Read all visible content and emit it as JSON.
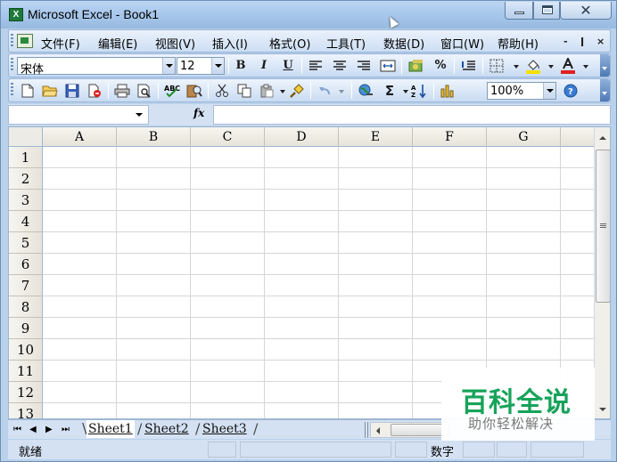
{
  "window": {
    "title": "Microsoft Excel - Book1",
    "close_glyph": "✕"
  },
  "menubar": {
    "items": [
      {
        "label": "文件",
        "mnemonic": "(F)"
      },
      {
        "label": "编辑",
        "mnemonic": "(E)"
      },
      {
        "label": "视图",
        "mnemonic": "(V)"
      },
      {
        "label": "插入",
        "mnemonic": "(I)"
      },
      {
        "label": "格式",
        "mnemonic": "(O)"
      },
      {
        "label": "工具",
        "mnemonic": "(T)"
      },
      {
        "label": "数据",
        "mnemonic": "(D)"
      },
      {
        "label": "窗口",
        "mnemonic": "(W)"
      },
      {
        "label": "帮助",
        "mnemonic": "(H)"
      }
    ],
    "doc_controls": [
      "-",
      "ǀ",
      "×"
    ]
  },
  "formatting_toolbar": {
    "font_name": "宋体",
    "font_size": "12",
    "bold": "B",
    "italic": "I",
    "underline": "U",
    "percent": "%",
    "font_color": "#e02020",
    "fill_color": "#f5e000"
  },
  "standard_toolbar": {
    "zoom": "100%",
    "autosum": "Σ"
  },
  "formula_bar": {
    "name_box_value": "",
    "fx_label": "fx",
    "formula_value": ""
  },
  "grid": {
    "columns": [
      "A",
      "B",
      "C",
      "D",
      "E",
      "F",
      "G"
    ],
    "rows": [
      "1",
      "2",
      "3",
      "4",
      "5",
      "6",
      "7",
      "8",
      "9",
      "10",
      "11",
      "12",
      "13"
    ]
  },
  "sheet_tabs": {
    "nav": [
      "⏮",
      "◀",
      "▶",
      "⏭"
    ],
    "tabs": [
      "Sheet1",
      "Sheet2",
      "Sheet3"
    ],
    "active": "Sheet1"
  },
  "status_bar": {
    "status": "就绪",
    "mode": "数字"
  },
  "watermark": {
    "title": "百科全说",
    "subtitle": "助你轻松解决",
    "color": "#17a35a"
  }
}
